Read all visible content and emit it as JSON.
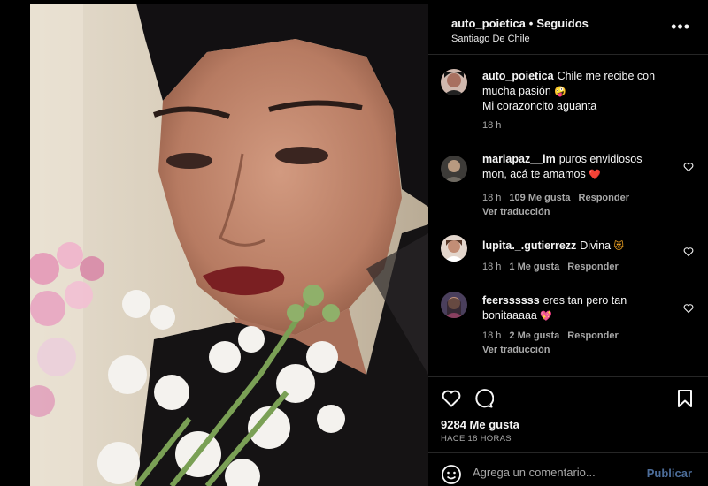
{
  "post": {
    "username": "auto_poietica",
    "separator": "•",
    "follow_state": "Seguidos",
    "location": "Santiago De Chile",
    "more_label": "•••"
  },
  "caption": {
    "username": "auto_poietica",
    "text": "Chile me recibe con mucha pasión",
    "emoji": "🤪",
    "line2": "Mi corazoncito aguanta",
    "time": "18 h"
  },
  "comments": [
    {
      "username": "mariapaz__lm",
      "text": "puros envidiosos mon, acá te amamos",
      "emoji": "❤️",
      "time": "18 h",
      "likes": "109 Me gusta",
      "reply": "Responder",
      "translate": "Ver traducción"
    },
    {
      "username": "lupita._.gutierrezz",
      "text": "Divina",
      "emoji": "😻",
      "time": "18 h",
      "likes": "1 Me gusta",
      "reply": "Responder",
      "translate": ""
    },
    {
      "username": "feerssssss",
      "text": "eres tan pero tan bonitaaaaa",
      "emoji": "💖",
      "time": "18 h",
      "likes": "2 Me gusta",
      "reply": "Responder",
      "translate": "Ver traducción"
    }
  ],
  "actions": {
    "likes": "9284 Me gusta",
    "posted": "HACE 18 HORAS"
  },
  "add_comment": {
    "placeholder": "Agrega un comentario...",
    "publish_label": "Publicar"
  },
  "icons": {
    "like": "heart-icon",
    "comment": "comment-icon",
    "save": "bookmark-icon",
    "emoji": "smiley-icon",
    "next": "chevron-right-icon",
    "more": "more-options-icon"
  },
  "colors": {
    "background": "#000000",
    "publish": "#4c6d9a",
    "secondary_text": "#a8a8a8",
    "divider": "#262626"
  }
}
